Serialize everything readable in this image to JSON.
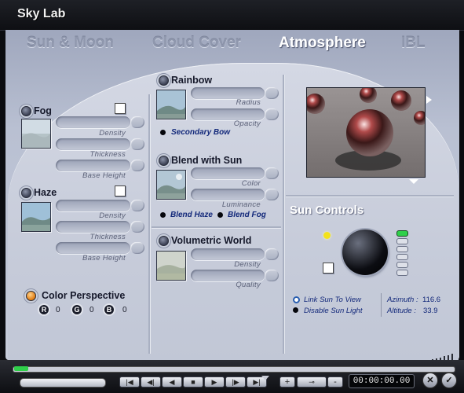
{
  "window": {
    "title": "Sky Lab"
  },
  "tabs": [
    {
      "label": "Sun & Moon",
      "active": false
    },
    {
      "label": "Cloud Cover",
      "active": false
    },
    {
      "label": "Atmosphere",
      "active": true
    },
    {
      "label": "IBL",
      "active": false
    }
  ],
  "fog": {
    "label": "Fog",
    "checked": false,
    "sliders": [
      "Density",
      "Thickness",
      "Base Height"
    ]
  },
  "haze": {
    "label": "Haze",
    "checked": false,
    "sliders": [
      "Density",
      "Thickness",
      "Base Height"
    ]
  },
  "color_perspective": {
    "label": "Color Perspective",
    "r_label": "R",
    "r_value": "0",
    "g_label": "G",
    "g_value": "0",
    "b_label": "B",
    "b_value": "0"
  },
  "rainbow": {
    "label": "Rainbow",
    "sliders": [
      "Radius",
      "Opacity"
    ],
    "secondary_bow": "Secondary Bow"
  },
  "blend_with_sun": {
    "label": "Blend with Sun",
    "sliders": [
      "Color",
      "Luminance"
    ],
    "blend_haze": "Blend Haze",
    "blend_fog": "Blend Fog"
  },
  "volumetric_world": {
    "label": "Volumetric World",
    "sliders": [
      "Density",
      "Quality"
    ]
  },
  "sun_controls": {
    "title": "Sun Controls",
    "link_sun_to_view": "Link Sun To View",
    "disable_sun_light": "Disable Sun Light",
    "azimuth_label": "Azimuth :",
    "azimuth_value": "116.6",
    "altitude_label": "Altitude :",
    "altitude_value": "33.9"
  },
  "timeline": {
    "time": "00:00:00.00",
    "add": "+",
    "subtract": "-",
    "key_icon": "key-icon"
  },
  "colors": {
    "accent_orange": "#e07a10",
    "sun_yellow": "#f3e21a",
    "indicator_green": "#2fd04a",
    "label_blue": "#12287a"
  }
}
